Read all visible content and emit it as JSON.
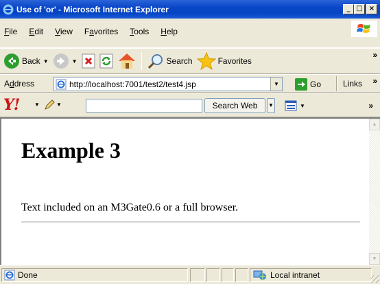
{
  "window": {
    "title": "Use of 'or' - Microsoft Internet Explorer",
    "buttons": {
      "minimize": "_",
      "maximize": "□",
      "close": "×"
    }
  },
  "menu": {
    "items": [
      {
        "prefix": "",
        "key": "F",
        "rest": "ile"
      },
      {
        "prefix": "",
        "key": "E",
        "rest": "dit"
      },
      {
        "prefix": "",
        "key": "V",
        "rest": "iew"
      },
      {
        "prefix": "F",
        "key": "a",
        "rest": "vorites"
      },
      {
        "prefix": "",
        "key": "T",
        "rest": "ools"
      },
      {
        "prefix": "",
        "key": "H",
        "rest": "elp"
      }
    ]
  },
  "toolbar": {
    "back_label": "Back",
    "search_label": "Search",
    "favorites_label": "Favorites",
    "more": "»"
  },
  "address": {
    "label_key": "d",
    "label_pre": "A",
    "label_post": "dress",
    "url": "http://localhost:7001/test2/test4.jsp",
    "go_label": "Go",
    "links_label": "Links",
    "more": "»"
  },
  "yahoo": {
    "logo": "Y!",
    "search_value": "",
    "search_web_label": "Search Web",
    "more": "»"
  },
  "page": {
    "heading": "Example 3",
    "text": "Text included on an M3Gate0.6 or a full browser."
  },
  "status": {
    "text": "Done",
    "zone": "Local intranet"
  },
  "colors": {
    "titlebar": "#0A46C8",
    "chrome": "#ECE9D8",
    "yahoo_red": "#D01010"
  }
}
